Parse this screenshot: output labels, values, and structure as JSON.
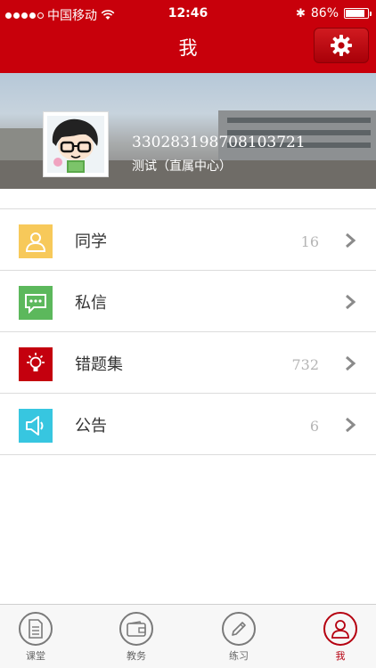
{
  "status_bar": {
    "carrier": "中国移动",
    "time": "12:46",
    "battery_text": "86%",
    "battery_level": 0.86
  },
  "nav": {
    "title": "我",
    "settings_icon": "gear-icon"
  },
  "profile": {
    "user_id": "330283198708103721",
    "org": "测试（直属中心）"
  },
  "menu": [
    {
      "label": "同学",
      "count": "16",
      "icon": "person-icon",
      "color": "#f7c95a"
    },
    {
      "label": "私信",
      "count": "",
      "icon": "chat-icon",
      "color": "#5cb85c"
    },
    {
      "label": "错题集",
      "count": "732",
      "icon": "lightbulb-icon",
      "color": "#c4000e"
    },
    {
      "label": "公告",
      "count": "6",
      "icon": "speaker-icon",
      "color": "#37c6e0"
    }
  ],
  "tabs": [
    {
      "label": "课堂",
      "icon": "document-icon"
    },
    {
      "label": "教务",
      "icon": "wallet-icon"
    },
    {
      "label": "练习",
      "icon": "pencil-icon"
    },
    {
      "label": "我",
      "icon": "user-icon",
      "active": true
    }
  ],
  "colors": {
    "brand": "#c8000b",
    "active_tab": "#b50010"
  }
}
